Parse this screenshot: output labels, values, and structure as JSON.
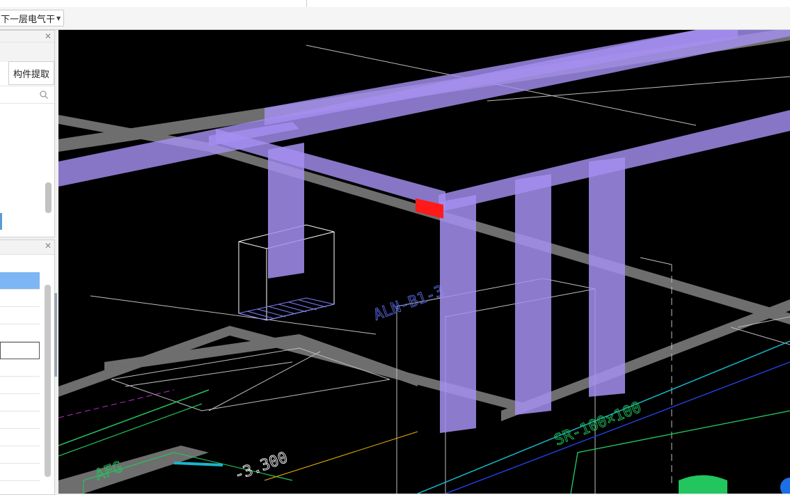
{
  "toolbar": {
    "floor_selector": "下一层电气干"
  },
  "left_panels": {
    "top": {
      "extract_button": "构件提取",
      "search_placeholder": ""
    },
    "bottom": {
      "rows": [
        "",
        "",
        "",
        "",
        "",
        "",
        "",
        "",
        "",
        "",
        "",
        ""
      ]
    }
  },
  "icons": {
    "close": "close-icon",
    "search": "search-icon",
    "dropdown": "chevron-down-icon"
  },
  "viewport": {
    "annotations": [
      "ALN-B1-3",
      "-3.300",
      "AFG",
      "SR-100×100"
    ],
    "colors": {
      "background": "#000000",
      "cable_tray": "#a58ff0",
      "highlight": "#ff1a1a",
      "wall": "#6e6e6e",
      "cad_green": "#22c55e",
      "cad_cyan": "#19b6c9"
    }
  }
}
